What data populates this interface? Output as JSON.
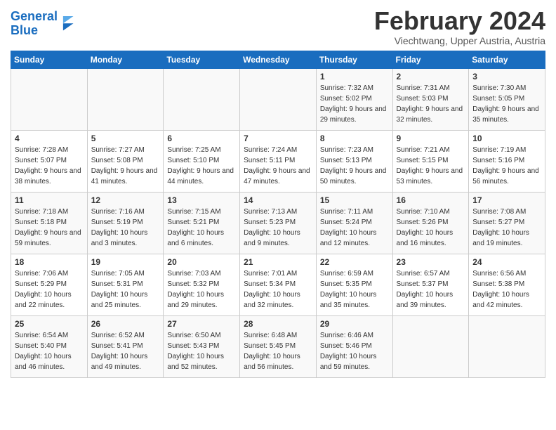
{
  "logo": {
    "text_general": "General",
    "text_blue": "Blue"
  },
  "title": "February 2024",
  "subtitle": "Viechtwang, Upper Austria, Austria",
  "weekdays": [
    "Sunday",
    "Monday",
    "Tuesday",
    "Wednesday",
    "Thursday",
    "Friday",
    "Saturday"
  ],
  "weeks": [
    [
      {
        "day": "",
        "sunrise": "",
        "sunset": "",
        "daylight": ""
      },
      {
        "day": "",
        "sunrise": "",
        "sunset": "",
        "daylight": ""
      },
      {
        "day": "",
        "sunrise": "",
        "sunset": "",
        "daylight": ""
      },
      {
        "day": "",
        "sunrise": "",
        "sunset": "",
        "daylight": ""
      },
      {
        "day": "1",
        "sunrise": "Sunrise: 7:32 AM",
        "sunset": "Sunset: 5:02 PM",
        "daylight": "Daylight: 9 hours and 29 minutes."
      },
      {
        "day": "2",
        "sunrise": "Sunrise: 7:31 AM",
        "sunset": "Sunset: 5:03 PM",
        "daylight": "Daylight: 9 hours and 32 minutes."
      },
      {
        "day": "3",
        "sunrise": "Sunrise: 7:30 AM",
        "sunset": "Sunset: 5:05 PM",
        "daylight": "Daylight: 9 hours and 35 minutes."
      }
    ],
    [
      {
        "day": "4",
        "sunrise": "Sunrise: 7:28 AM",
        "sunset": "Sunset: 5:07 PM",
        "daylight": "Daylight: 9 hours and 38 minutes."
      },
      {
        "day": "5",
        "sunrise": "Sunrise: 7:27 AM",
        "sunset": "Sunset: 5:08 PM",
        "daylight": "Daylight: 9 hours and 41 minutes."
      },
      {
        "day": "6",
        "sunrise": "Sunrise: 7:25 AM",
        "sunset": "Sunset: 5:10 PM",
        "daylight": "Daylight: 9 hours and 44 minutes."
      },
      {
        "day": "7",
        "sunrise": "Sunrise: 7:24 AM",
        "sunset": "Sunset: 5:11 PM",
        "daylight": "Daylight: 9 hours and 47 minutes."
      },
      {
        "day": "8",
        "sunrise": "Sunrise: 7:23 AM",
        "sunset": "Sunset: 5:13 PM",
        "daylight": "Daylight: 9 hours and 50 minutes."
      },
      {
        "day": "9",
        "sunrise": "Sunrise: 7:21 AM",
        "sunset": "Sunset: 5:15 PM",
        "daylight": "Daylight: 9 hours and 53 minutes."
      },
      {
        "day": "10",
        "sunrise": "Sunrise: 7:19 AM",
        "sunset": "Sunset: 5:16 PM",
        "daylight": "Daylight: 9 hours and 56 minutes."
      }
    ],
    [
      {
        "day": "11",
        "sunrise": "Sunrise: 7:18 AM",
        "sunset": "Sunset: 5:18 PM",
        "daylight": "Daylight: 9 hours and 59 minutes."
      },
      {
        "day": "12",
        "sunrise": "Sunrise: 7:16 AM",
        "sunset": "Sunset: 5:19 PM",
        "daylight": "Daylight: 10 hours and 3 minutes."
      },
      {
        "day": "13",
        "sunrise": "Sunrise: 7:15 AM",
        "sunset": "Sunset: 5:21 PM",
        "daylight": "Daylight: 10 hours and 6 minutes."
      },
      {
        "day": "14",
        "sunrise": "Sunrise: 7:13 AM",
        "sunset": "Sunset: 5:23 PM",
        "daylight": "Daylight: 10 hours and 9 minutes."
      },
      {
        "day": "15",
        "sunrise": "Sunrise: 7:11 AM",
        "sunset": "Sunset: 5:24 PM",
        "daylight": "Daylight: 10 hours and 12 minutes."
      },
      {
        "day": "16",
        "sunrise": "Sunrise: 7:10 AM",
        "sunset": "Sunset: 5:26 PM",
        "daylight": "Daylight: 10 hours and 16 minutes."
      },
      {
        "day": "17",
        "sunrise": "Sunrise: 7:08 AM",
        "sunset": "Sunset: 5:27 PM",
        "daylight": "Daylight: 10 hours and 19 minutes."
      }
    ],
    [
      {
        "day": "18",
        "sunrise": "Sunrise: 7:06 AM",
        "sunset": "Sunset: 5:29 PM",
        "daylight": "Daylight: 10 hours and 22 minutes."
      },
      {
        "day": "19",
        "sunrise": "Sunrise: 7:05 AM",
        "sunset": "Sunset: 5:31 PM",
        "daylight": "Daylight: 10 hours and 25 minutes."
      },
      {
        "day": "20",
        "sunrise": "Sunrise: 7:03 AM",
        "sunset": "Sunset: 5:32 PM",
        "daylight": "Daylight: 10 hours and 29 minutes."
      },
      {
        "day": "21",
        "sunrise": "Sunrise: 7:01 AM",
        "sunset": "Sunset: 5:34 PM",
        "daylight": "Daylight: 10 hours and 32 minutes."
      },
      {
        "day": "22",
        "sunrise": "Sunrise: 6:59 AM",
        "sunset": "Sunset: 5:35 PM",
        "daylight": "Daylight: 10 hours and 35 minutes."
      },
      {
        "day": "23",
        "sunrise": "Sunrise: 6:57 AM",
        "sunset": "Sunset: 5:37 PM",
        "daylight": "Daylight: 10 hours and 39 minutes."
      },
      {
        "day": "24",
        "sunrise": "Sunrise: 6:56 AM",
        "sunset": "Sunset: 5:38 PM",
        "daylight": "Daylight: 10 hours and 42 minutes."
      }
    ],
    [
      {
        "day": "25",
        "sunrise": "Sunrise: 6:54 AM",
        "sunset": "Sunset: 5:40 PM",
        "daylight": "Daylight: 10 hours and 46 minutes."
      },
      {
        "day": "26",
        "sunrise": "Sunrise: 6:52 AM",
        "sunset": "Sunset: 5:41 PM",
        "daylight": "Daylight: 10 hours and 49 minutes."
      },
      {
        "day": "27",
        "sunrise": "Sunrise: 6:50 AM",
        "sunset": "Sunset: 5:43 PM",
        "daylight": "Daylight: 10 hours and 52 minutes."
      },
      {
        "day": "28",
        "sunrise": "Sunrise: 6:48 AM",
        "sunset": "Sunset: 5:45 PM",
        "daylight": "Daylight: 10 hours and 56 minutes."
      },
      {
        "day": "29",
        "sunrise": "Sunrise: 6:46 AM",
        "sunset": "Sunset: 5:46 PM",
        "daylight": "Daylight: 10 hours and 59 minutes."
      },
      {
        "day": "",
        "sunrise": "",
        "sunset": "",
        "daylight": ""
      },
      {
        "day": "",
        "sunrise": "",
        "sunset": "",
        "daylight": ""
      }
    ]
  ]
}
